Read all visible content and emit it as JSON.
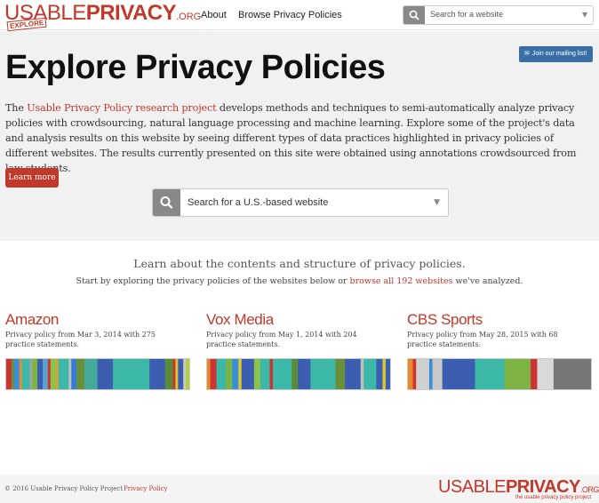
{
  "colors": {
    "accent": "#c0392b",
    "hero_bg": "#f1f1f1",
    "mail_button": "#3a6fa5"
  },
  "navbar": {
    "logo": {
      "thin": "USABLE",
      "bold": "PRIVACY",
      "org": ".ORG",
      "stamp": "EXPLORE"
    },
    "links": [
      "About",
      "Browse Privacy Policies"
    ],
    "search": {
      "icon": "search-icon",
      "placeholder": "Search for a website"
    }
  },
  "hero": {
    "title": "Explore Privacy Policies",
    "mail_button": "Join our mailing list!",
    "intro": {
      "prefix": "The ",
      "link": "Usable Privacy Policy research project",
      "text": " develops methods and techniques to semi-automatically analyze privacy policies with crowdsourcing, natural language processing and machine learning. Explore some of the project's data and analysis results on this website by seeing different types of data practices highlighted in privacy policies of different websites. The results currently presented on this site were obtained using annotations crowdsourced from law students."
    },
    "learn_more": "Learn more",
    "search": {
      "icon": "search-icon",
      "placeholder": "Search for a U.S.-based website"
    }
  },
  "content": {
    "lead": "Learn about the contents and structure of privacy policies.",
    "sublead_prefix": "Start by exploring the privacy policies of the websites below or ",
    "sublead_link": "browse all 192 websites",
    "sublead_suffix": " we've analyzed.",
    "sites": [
      {
        "name": "Amazon",
        "description": "Privacy policy from Mar 3, 2014 with 275 practice statements.",
        "segments": [
          [
            "#cc3333",
            2
          ],
          [
            "#6a8f3a",
            1
          ],
          [
            "#3a8ed8",
            2
          ],
          [
            "#e88a2a",
            1
          ],
          [
            "#3cb8a8",
            3
          ],
          [
            "#a0a0a0",
            1
          ],
          [
            "#7cb342",
            2
          ],
          [
            "#3c5eb0",
            2
          ],
          [
            "#5a9fd0",
            2
          ],
          [
            "#cc3333",
            1
          ],
          [
            "#8bc34a",
            2
          ],
          [
            "#e0a030",
            1
          ],
          [
            "#3cb8a8",
            4
          ],
          [
            "#c0c0c0",
            1
          ],
          [
            "#3a7bd5",
            2
          ],
          [
            "#6a8f3a",
            3
          ],
          [
            "#44aa99",
            5
          ],
          [
            "#3c5eb0",
            6
          ],
          [
            "#3cb8a8",
            14
          ],
          [
            "#3c5eb0",
            6
          ],
          [
            "#5a8a3a",
            3
          ],
          [
            "#cc3333",
            1
          ],
          [
            "#d9c730",
            1
          ],
          [
            "#3c5eb0",
            2
          ],
          [
            "#c8c8c8",
            1
          ],
          [
            "#aed23a",
            2
          ]
        ]
      },
      {
        "name": "Vox Media",
        "description": "Privacy policy from May 1, 2014 with 204 practice statements.",
        "segments": [
          [
            "#e88a2a",
            1
          ],
          [
            "#cc3333",
            2
          ],
          [
            "#3cb8a8",
            3
          ],
          [
            "#7cb342",
            2
          ],
          [
            "#3a8ed8",
            2
          ],
          [
            "#d9c730",
            1
          ],
          [
            "#3c5eb0",
            4
          ],
          [
            "#8bc34a",
            2
          ],
          [
            "#3cb8a8",
            3
          ],
          [
            "#cc3333",
            1
          ],
          [
            "#3cb8a8",
            6
          ],
          [
            "#5a8a3a",
            2
          ],
          [
            "#3c5eb0",
            4
          ],
          [
            "#3cb8a8",
            8
          ],
          [
            "#6a8f3a",
            3
          ],
          [
            "#3c5eb0",
            5
          ],
          [
            "#c0c0c0",
            1
          ],
          [
            "#3cb8a8",
            4
          ],
          [
            "#3c5eb0",
            2
          ],
          [
            "#d9c730",
            1
          ],
          [
            "#3c5eb0",
            2
          ]
        ]
      },
      {
        "name": "CBS Sports",
        "description": "Privacy policy from May 28, 2015 with 68 practice statements.",
        "segments": [
          [
            "#e88a2a",
            3
          ],
          [
            "#cc3333",
            2
          ],
          [
            "#d0d0d0",
            8
          ],
          [
            "#3a8ed8",
            2
          ],
          [
            "#c8c8c8",
            6
          ],
          [
            "#3c5eb0",
            20
          ],
          [
            "#3cb8a8",
            18
          ],
          [
            "#7cb342",
            16
          ],
          [
            "#cc3333",
            4
          ],
          [
            "#d9d9d9",
            10
          ],
          [
            "#777777",
            24
          ]
        ]
      }
    ]
  },
  "footer": {
    "copyright": "© 2016 Usable Privacy Policy Project",
    "privacy_link": "Privacy Policy",
    "logo": {
      "thin": "USABLE",
      "bold": "PRIVACY",
      "org": ".ORG",
      "tagline": "the usable privacy policy project"
    }
  }
}
